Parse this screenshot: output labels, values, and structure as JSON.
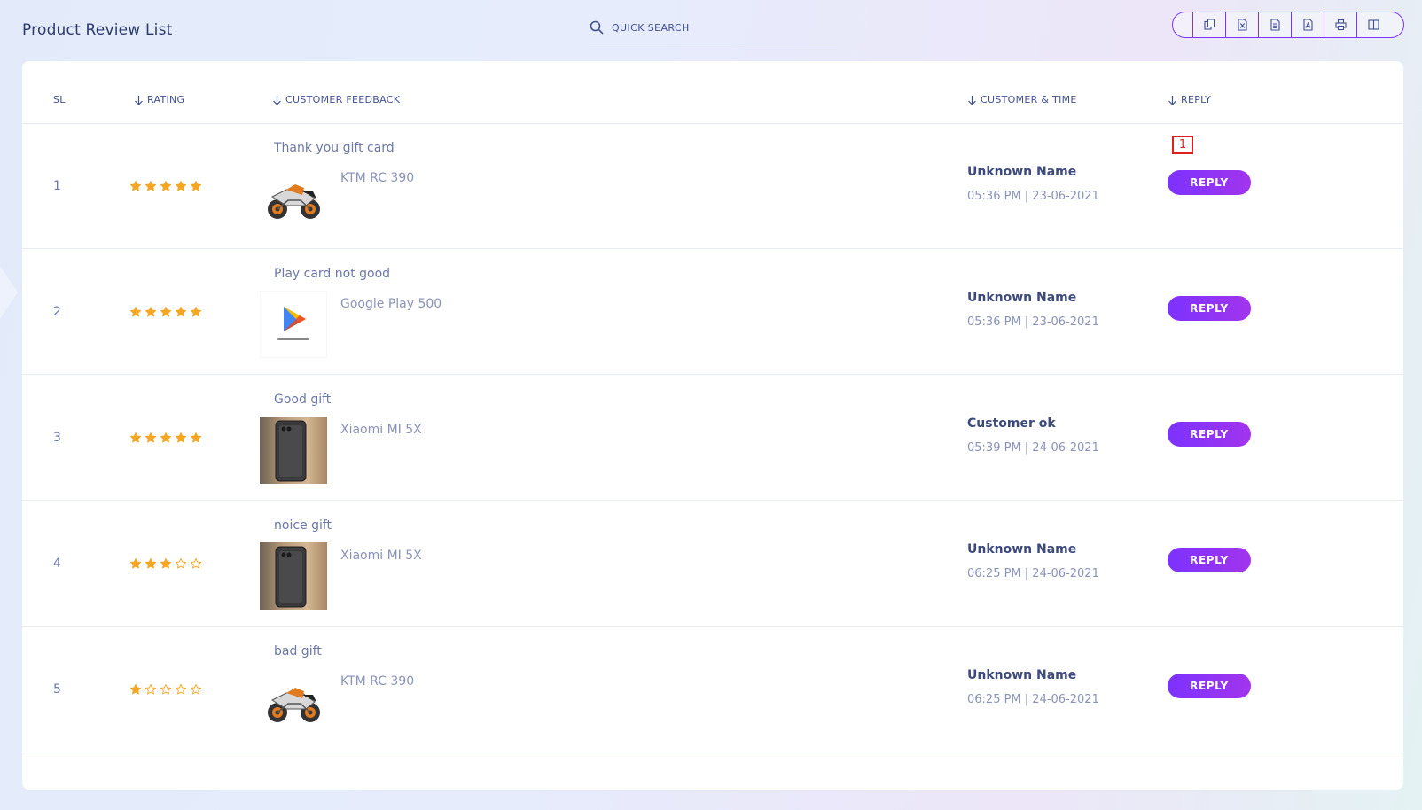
{
  "page": {
    "title": "Product Review List"
  },
  "search": {
    "placeholder": "QUICK SEARCH"
  },
  "toolbar": {
    "buttons": [
      {
        "name": "copy-icon"
      },
      {
        "name": "excel-icon"
      },
      {
        "name": "csv-icon"
      },
      {
        "name": "pdf-icon"
      },
      {
        "name": "print-icon"
      },
      {
        "name": "columns-icon"
      }
    ]
  },
  "table": {
    "columns": {
      "sl": "SL",
      "rating": "RATING",
      "feedback": "CUSTOMER FEEDBACK",
      "customer": "CUSTOMER & TIME",
      "reply": "REPLY"
    },
    "rows": [
      {
        "sl": "1",
        "rating": 5,
        "feedback": "Thank you gift card",
        "product": "KTM RC 390",
        "product_image": "motorcycle",
        "customer": "Unknown Name",
        "time": "05:36 PM | 23-06-2021",
        "reply_label": "REPLY"
      },
      {
        "sl": "2",
        "rating": 5,
        "feedback": "Play card not good",
        "product": "Google Play 500",
        "product_image": "google-play",
        "customer": "Unknown Name",
        "time": "05:36 PM | 23-06-2021",
        "reply_label": "REPLY"
      },
      {
        "sl": "3",
        "rating": 5,
        "feedback": "Good gift",
        "product": "Xiaomi MI 5X",
        "product_image": "phone",
        "customer": "Customer ok",
        "time": "05:39 PM | 24-06-2021",
        "reply_label": "REPLY"
      },
      {
        "sl": "4",
        "rating": 3,
        "feedback": "noice gift",
        "product": "Xiaomi MI 5X",
        "product_image": "phone",
        "customer": "Unknown Name",
        "time": "06:25 PM | 24-06-2021",
        "reply_label": "REPLY"
      },
      {
        "sl": "5",
        "rating": 1,
        "feedback": "bad gift",
        "product": "KTM RC 390",
        "product_image": "motorcycle",
        "customer": "Unknown Name",
        "time": "06:25 PM | 24-06-2021",
        "reply_label": "REPLY"
      }
    ]
  },
  "annotation": {
    "badge_label": "1"
  },
  "colors": {
    "accent": "#7c32ff",
    "star": "#f5a623",
    "badge": "#e02020"
  }
}
